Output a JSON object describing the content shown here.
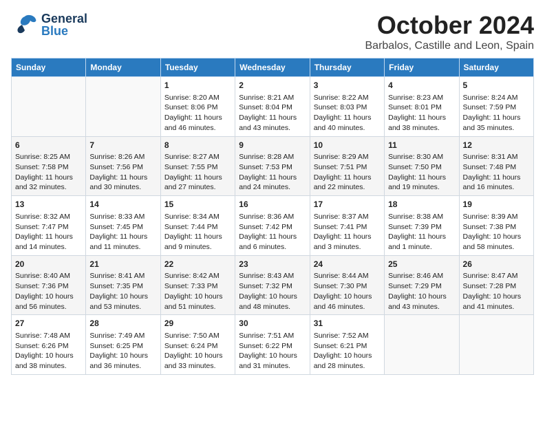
{
  "header": {
    "logo_general": "General",
    "logo_blue": "Blue",
    "title": "October 2024",
    "subtitle": "Barbalos, Castille and Leon, Spain"
  },
  "calendar": {
    "days_of_week": [
      "Sunday",
      "Monday",
      "Tuesday",
      "Wednesday",
      "Thursday",
      "Friday",
      "Saturday"
    ],
    "weeks": [
      [
        {
          "day": "",
          "content": ""
        },
        {
          "day": "",
          "content": ""
        },
        {
          "day": "1",
          "content": "Sunrise: 8:20 AM\nSunset: 8:06 PM\nDaylight: 11 hours and 46 minutes."
        },
        {
          "day": "2",
          "content": "Sunrise: 8:21 AM\nSunset: 8:04 PM\nDaylight: 11 hours and 43 minutes."
        },
        {
          "day": "3",
          "content": "Sunrise: 8:22 AM\nSunset: 8:03 PM\nDaylight: 11 hours and 40 minutes."
        },
        {
          "day": "4",
          "content": "Sunrise: 8:23 AM\nSunset: 8:01 PM\nDaylight: 11 hours and 38 minutes."
        },
        {
          "day": "5",
          "content": "Sunrise: 8:24 AM\nSunset: 7:59 PM\nDaylight: 11 hours and 35 minutes."
        }
      ],
      [
        {
          "day": "6",
          "content": "Sunrise: 8:25 AM\nSunset: 7:58 PM\nDaylight: 11 hours and 32 minutes."
        },
        {
          "day": "7",
          "content": "Sunrise: 8:26 AM\nSunset: 7:56 PM\nDaylight: 11 hours and 30 minutes."
        },
        {
          "day": "8",
          "content": "Sunrise: 8:27 AM\nSunset: 7:55 PM\nDaylight: 11 hours and 27 minutes."
        },
        {
          "day": "9",
          "content": "Sunrise: 8:28 AM\nSunset: 7:53 PM\nDaylight: 11 hours and 24 minutes."
        },
        {
          "day": "10",
          "content": "Sunrise: 8:29 AM\nSunset: 7:51 PM\nDaylight: 11 hours and 22 minutes."
        },
        {
          "day": "11",
          "content": "Sunrise: 8:30 AM\nSunset: 7:50 PM\nDaylight: 11 hours and 19 minutes."
        },
        {
          "day": "12",
          "content": "Sunrise: 8:31 AM\nSunset: 7:48 PM\nDaylight: 11 hours and 16 minutes."
        }
      ],
      [
        {
          "day": "13",
          "content": "Sunrise: 8:32 AM\nSunset: 7:47 PM\nDaylight: 11 hours and 14 minutes."
        },
        {
          "day": "14",
          "content": "Sunrise: 8:33 AM\nSunset: 7:45 PM\nDaylight: 11 hours and 11 minutes."
        },
        {
          "day": "15",
          "content": "Sunrise: 8:34 AM\nSunset: 7:44 PM\nDaylight: 11 hours and 9 minutes."
        },
        {
          "day": "16",
          "content": "Sunrise: 8:36 AM\nSunset: 7:42 PM\nDaylight: 11 hours and 6 minutes."
        },
        {
          "day": "17",
          "content": "Sunrise: 8:37 AM\nSunset: 7:41 PM\nDaylight: 11 hours and 3 minutes."
        },
        {
          "day": "18",
          "content": "Sunrise: 8:38 AM\nSunset: 7:39 PM\nDaylight: 11 hours and 1 minute."
        },
        {
          "day": "19",
          "content": "Sunrise: 8:39 AM\nSunset: 7:38 PM\nDaylight: 10 hours and 58 minutes."
        }
      ],
      [
        {
          "day": "20",
          "content": "Sunrise: 8:40 AM\nSunset: 7:36 PM\nDaylight: 10 hours and 56 minutes."
        },
        {
          "day": "21",
          "content": "Sunrise: 8:41 AM\nSunset: 7:35 PM\nDaylight: 10 hours and 53 minutes."
        },
        {
          "day": "22",
          "content": "Sunrise: 8:42 AM\nSunset: 7:33 PM\nDaylight: 10 hours and 51 minutes."
        },
        {
          "day": "23",
          "content": "Sunrise: 8:43 AM\nSunset: 7:32 PM\nDaylight: 10 hours and 48 minutes."
        },
        {
          "day": "24",
          "content": "Sunrise: 8:44 AM\nSunset: 7:30 PM\nDaylight: 10 hours and 46 minutes."
        },
        {
          "day": "25",
          "content": "Sunrise: 8:46 AM\nSunset: 7:29 PM\nDaylight: 10 hours and 43 minutes."
        },
        {
          "day": "26",
          "content": "Sunrise: 8:47 AM\nSunset: 7:28 PM\nDaylight: 10 hours and 41 minutes."
        }
      ],
      [
        {
          "day": "27",
          "content": "Sunrise: 7:48 AM\nSunset: 6:26 PM\nDaylight: 10 hours and 38 minutes."
        },
        {
          "day": "28",
          "content": "Sunrise: 7:49 AM\nSunset: 6:25 PM\nDaylight: 10 hours and 36 minutes."
        },
        {
          "day": "29",
          "content": "Sunrise: 7:50 AM\nSunset: 6:24 PM\nDaylight: 10 hours and 33 minutes."
        },
        {
          "day": "30",
          "content": "Sunrise: 7:51 AM\nSunset: 6:22 PM\nDaylight: 10 hours and 31 minutes."
        },
        {
          "day": "31",
          "content": "Sunrise: 7:52 AM\nSunset: 6:21 PM\nDaylight: 10 hours and 28 minutes."
        },
        {
          "day": "",
          "content": ""
        },
        {
          "day": "",
          "content": ""
        }
      ]
    ]
  }
}
